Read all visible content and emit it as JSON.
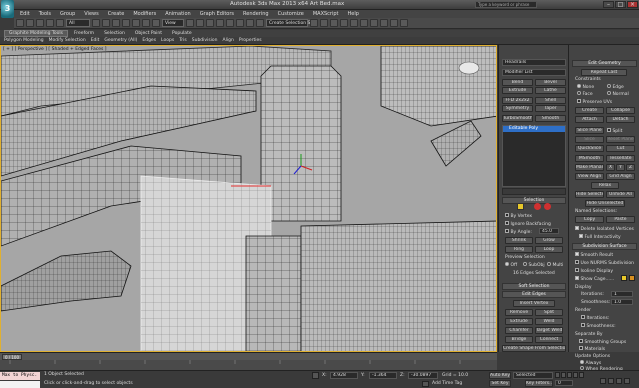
{
  "app": {
    "logo": "3",
    "title": "Autodesk 3ds Max 2013 x64   Art Bed.max",
    "search_placeholder": "Type a keyword or phrase"
  },
  "menu": [
    "Edit",
    "Tools",
    "Group",
    "Views",
    "Create",
    "Modifiers",
    "Animation",
    "Graph Editors",
    "Rendering",
    "Customize",
    "MAXScript",
    "Help"
  ],
  "toolbar": {
    "filter_value": "All",
    "refcoord_value": "View",
    "selection_set": "Create Selection Se"
  },
  "ribbon": {
    "tabs": [
      "Graphite Modeling Tools",
      "Freeform",
      "Selection",
      "Object Paint",
      "Populate"
    ],
    "active_tab": 0,
    "subtabs": [
      "Polygon Modeling",
      "Modify Selection",
      "Edit",
      "Geometry (All)",
      "Edges",
      "Loops",
      "Tris",
      "Subdivision",
      "Align",
      "Properties"
    ]
  },
  "viewport": {
    "label": "[ + ] [ Perspective ] [ Shaded + Edged Faces ]",
    "border_color": "#e0b030",
    "background": "#a6a6a6"
  },
  "cmdpanel": {
    "object_name": "Headrails",
    "modifier_list": "Modifier List",
    "buttons": [
      "Bend",
      "Bevel",
      "Extrude",
      "Lathe",
      "FFD 2x2x2",
      "Shell",
      "Symmetry",
      "Taper",
      "TurboSmooth",
      "Smooth"
    ],
    "stack_item": "Editable Poly",
    "selection_header": "Selection",
    "by_vertex": "By Vertex",
    "ignore_backfacing": "Ignore Backfacing",
    "by_angle": "By Angle:",
    "by_angle_value": "45.0",
    "shrink": "Shrink",
    "grow": "Grow",
    "ring": "Ring",
    "loop": "Loop",
    "preview_label": "Preview Selection",
    "preview_off": "Off",
    "preview_subobj": "SubObj",
    "preview_multi": "Multi",
    "selected_count": "16 Edges Selected",
    "soft_selection": "Soft Selection",
    "edit_edges": "Edit Edges",
    "insert_vertex": "Insert Vertex",
    "remove": "Remove",
    "split": "Split",
    "extrude": "Extrude",
    "weld": "Weld",
    "chamfer": "Chamfer",
    "target_weld": "Target Weld",
    "bridge": "Bridge",
    "connect": "Connect",
    "create_shape": "Create Shape From Selection",
    "weight_label": "Weight:",
    "weight_value": "1.0",
    "crease_label": "Crease:",
    "crease_value": "0.0"
  },
  "rollout": {
    "edit_geometry": "Edit Geometry",
    "repeat_last": "Repeat Last",
    "constraints": "Constraints",
    "c_none": "None",
    "c_edge": "Edge",
    "c_face": "Face",
    "c_normal": "Normal",
    "preserve_uvs": "Preserve UVs",
    "create": "Create",
    "collapse": "Collapse",
    "attach": "Attach",
    "detach": "Detach",
    "slice_plane": "Slice Plane",
    "split": "Split",
    "slice": "Slice",
    "reset_plane": "Reset Plane",
    "quickslice": "QuickSlice",
    "cut": "Cut",
    "msmooth": "MSmooth",
    "tessellate": "Tessellate",
    "make_planar": "Make Planar",
    "x": "X",
    "y": "Y",
    "z": "Z",
    "view_align": "View Align",
    "grid_align": "Grid Align",
    "relax": "Relax",
    "hide_selected": "Hide Selected",
    "unhide_all": "Unhide All",
    "hide_unselected": "Hide Unselected",
    "named_selections": "Named Selections:",
    "copy": "Copy",
    "paste": "Paste",
    "delete_isolated": "Delete Isolated Vertices",
    "full_interactivity": "Full Interactivity",
    "subdivision_surface": "Subdivision Surface",
    "smooth_result": "Smooth Result",
    "use_nurms": "Use NURMS Subdivision",
    "isoline_display": "Isoline Display",
    "show_cage": "Show Cage......",
    "display": "Display",
    "iterations": "Iterations:",
    "iterations_value": "1",
    "smoothness": "Smoothness:",
    "smoothness_value": "1.0",
    "render": "Render",
    "separate_by": "Separate By",
    "smoothing_groups": "Smoothing Groups",
    "materials": "Materials",
    "update_options": "Update Options",
    "always": "Always",
    "when_rendering": "When Rendering",
    "manually": "Manually"
  },
  "timeline": {
    "frame": "0 / 100"
  },
  "status": {
    "maxscript": "Max to Physc.",
    "selected": "1 Object Selected",
    "prompt": "Click or click-and-drag to select objects",
    "x_label": "X:",
    "x_value": "4.928",
    "y_label": "Y:",
    "y_value": "-1.364",
    "z_label": "Z:",
    "z_value": "-30.0897",
    "grid_label": "Grid = 10.0",
    "auto_key": "Auto Key",
    "selected_dropdown": "Selected",
    "set_key": "Set Key",
    "key_filters": "Key Filters...",
    "add_time_tag": "Add Time Tag",
    "frame_value": "0"
  }
}
